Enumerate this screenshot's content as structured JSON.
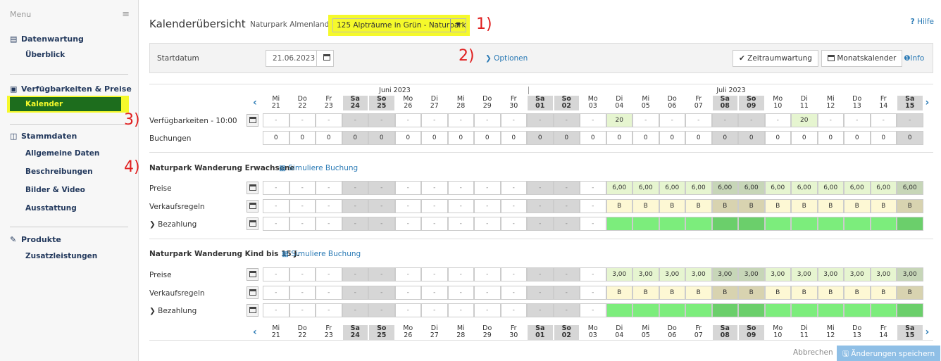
{
  "sidebar": {
    "menu_label": "Menu",
    "sections": [
      {
        "label": "Datenwartung",
        "icon": "document-icon",
        "items": [
          "Überblick"
        ]
      },
      {
        "label": "Verfügbarkeiten & Preise",
        "icon": "money-icon",
        "items": [
          "Kalender"
        ]
      },
      {
        "label": "Stammdaten",
        "icon": "columns-icon",
        "items": [
          "Allgemeine Daten",
          "Beschreibungen",
          "Bilder & Video",
          "Ausstattung"
        ]
      },
      {
        "label": "Produkte",
        "icon": "tag-icon",
        "items": [
          "Zusatzleistungen"
        ]
      }
    ],
    "active_item": "Kalender"
  },
  "header": {
    "title": "Kalenderübersicht",
    "region": "Naturpark Almenland",
    "product_select": "125 Alpträume in Grün - Naturpark W",
    "help": "Hilfe"
  },
  "toolbar": {
    "start_label": "Startdatum",
    "start_value": "21.06.2023",
    "options": "Optionen",
    "period_button": "Zeitraumwartung",
    "month_button": "Monatskalender",
    "info": "Info"
  },
  "annotations": [
    "1)",
    "2)",
    "3)",
    "4)"
  ],
  "calendar": {
    "months": [
      "Juni 2023",
      "Juli 2023"
    ],
    "days": [
      {
        "wd": "Mi",
        "d": "21",
        "we": false
      },
      {
        "wd": "Do",
        "d": "22",
        "we": false
      },
      {
        "wd": "Fr",
        "d": "23",
        "we": false
      },
      {
        "wd": "Sa",
        "d": "24",
        "we": true
      },
      {
        "wd": "So",
        "d": "25",
        "we": true
      },
      {
        "wd": "Mo",
        "d": "26",
        "we": false
      },
      {
        "wd": "Di",
        "d": "27",
        "we": false
      },
      {
        "wd": "Mi",
        "d": "28",
        "we": false
      },
      {
        "wd": "Do",
        "d": "29",
        "we": false
      },
      {
        "wd": "Fr",
        "d": "30",
        "we": false
      },
      {
        "wd": "Sa",
        "d": "01",
        "we": true
      },
      {
        "wd": "So",
        "d": "02",
        "we": true
      },
      {
        "wd": "Mo",
        "d": "03",
        "we": false
      },
      {
        "wd": "Di",
        "d": "04",
        "we": false
      },
      {
        "wd": "Mi",
        "d": "05",
        "we": false
      },
      {
        "wd": "Do",
        "d": "06",
        "we": false
      },
      {
        "wd": "Fr",
        "d": "07",
        "we": false
      },
      {
        "wd": "Sa",
        "d": "08",
        "we": true
      },
      {
        "wd": "So",
        "d": "09",
        "we": true
      },
      {
        "wd": "Mo",
        "d": "10",
        "we": false
      },
      {
        "wd": "Di",
        "d": "11",
        "we": false
      },
      {
        "wd": "Mi",
        "d": "12",
        "we": false
      },
      {
        "wd": "Do",
        "d": "13",
        "we": false
      },
      {
        "wd": "Fr",
        "d": "14",
        "we": false
      },
      {
        "wd": "Sa",
        "d": "15",
        "we": true
      }
    ],
    "availability_label": "Verfügbarkeiten - 10:00",
    "availability": [
      "-",
      "-",
      "-",
      "-",
      "-",
      "-",
      "-",
      "-",
      "-",
      "-",
      "-",
      "-",
      "-",
      "20",
      "-",
      "-",
      "-",
      "-",
      "-",
      "-",
      "20",
      "-",
      "-",
      "-",
      "-"
    ],
    "bookings_label": "Buchungen",
    "bookings": [
      "0",
      "0",
      "0",
      "0",
      "0",
      "0",
      "0",
      "0",
      "0",
      "0",
      "0",
      "0",
      "0",
      "0",
      "0",
      "0",
      "0",
      "0",
      "0",
      "0",
      "0",
      "0",
      "0",
      "0",
      "0"
    ],
    "simulate_label": "Simuliere Buchung",
    "products": [
      {
        "name": "Naturpark Wanderung Erwachsene",
        "price_label": "Preise",
        "rules_label": "Verkaufsregeln",
        "payment_label": "Bezahlung",
        "prices": [
          "-",
          "-",
          "-",
          "-",
          "-",
          "-",
          "-",
          "-",
          "-",
          "-",
          "-",
          "-",
          "-",
          "6,00",
          "6,00",
          "6,00",
          "6,00",
          "6,00",
          "6,00",
          "6,00",
          "6,00",
          "6,00",
          "6,00",
          "6,00",
          "6,00"
        ],
        "rules": [
          "-",
          "-",
          "-",
          "-",
          "-",
          "-",
          "-",
          "-",
          "-",
          "-",
          "-",
          "-",
          "-",
          "B",
          "B",
          "B",
          "B",
          "B",
          "B",
          "B",
          "B",
          "B",
          "B",
          "B",
          "B"
        ],
        "payment": [
          "-",
          "-",
          "-",
          "-",
          "-",
          "-",
          "-",
          "-",
          "-",
          "-",
          "-",
          "-",
          "-",
          "",
          "",
          "",
          "",
          "",
          "",
          "",
          "",
          "",
          "",
          "",
          ""
        ]
      },
      {
        "name": "Naturpark Wanderung Kind bis 15 J.",
        "price_label": "Preise",
        "rules_label": "Verkaufsregeln",
        "payment_label": "Bezahlung",
        "prices": [
          "-",
          "-",
          "-",
          "-",
          "-",
          "-",
          "-",
          "-",
          "-",
          "-",
          "-",
          "-",
          "-",
          "3,00",
          "3,00",
          "3,00",
          "3,00",
          "3,00",
          "3,00",
          "3,00",
          "3,00",
          "3,00",
          "3,00",
          "3,00",
          "3,00"
        ],
        "rules": [
          "-",
          "-",
          "-",
          "-",
          "-",
          "-",
          "-",
          "-",
          "-",
          "-",
          "-",
          "-",
          "-",
          "B",
          "B",
          "B",
          "B",
          "B",
          "B",
          "B",
          "B",
          "B",
          "B",
          "B",
          "B"
        ],
        "payment": [
          "-",
          "-",
          "-",
          "-",
          "-",
          "-",
          "-",
          "-",
          "-",
          "-",
          "-",
          "-",
          "-",
          "",
          "",
          "",
          "",
          "",
          "",
          "",
          "",
          "",
          "",
          "",
          ""
        ]
      }
    ]
  },
  "footer": {
    "cancel": "Abbrechen",
    "save": "Änderungen speichern"
  },
  "colors": {
    "highlight": "#f5f92b",
    "active_bg": "#1d6d1d",
    "link": "#2a7ab5",
    "green_cell": "#7ced7c",
    "green_cell_we": "#6bcf6b",
    "price_cell": "#e6f5d0",
    "rule_cell": "#fdf8d4",
    "rule_cell_we": "#d8d3b0",
    "weekend": "#d6d6d6",
    "annotation": "#e02020"
  }
}
